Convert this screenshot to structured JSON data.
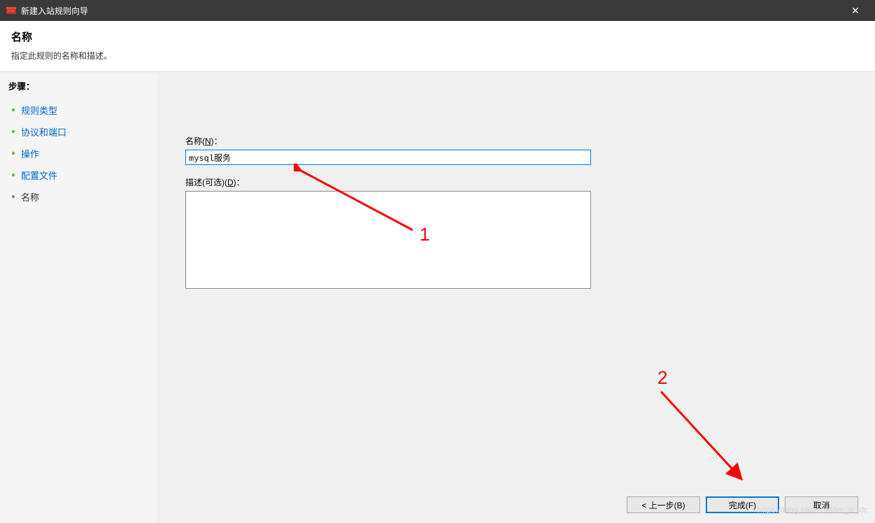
{
  "titlebar": {
    "title": "新建入站规则向导"
  },
  "header": {
    "title": "名称",
    "description": "指定此规则的名称和描述。"
  },
  "sidebar": {
    "steps_label": "步骤：",
    "steps": [
      {
        "label": "规则类型",
        "is_current": false
      },
      {
        "label": "协议和端口",
        "is_current": false
      },
      {
        "label": "操作",
        "is_current": false
      },
      {
        "label": "配置文件",
        "is_current": false
      },
      {
        "label": "名称",
        "is_current": true
      }
    ]
  },
  "form": {
    "name_label_prefix": "名称(",
    "name_label_key": "N",
    "name_label_suffix": ")：",
    "name_value": "mysql服务",
    "desc_label_prefix": "描述(可选)(",
    "desc_label_key": "D",
    "desc_label_suffix": ")：",
    "desc_value": ""
  },
  "footer": {
    "back": "< 上一步(B)",
    "finish": "完成(F)",
    "cancel": "取消"
  },
  "annotations": {
    "label1": "1",
    "label2": "2"
  },
  "watermark": "https://blog.csdn.net/lm_is_dc"
}
